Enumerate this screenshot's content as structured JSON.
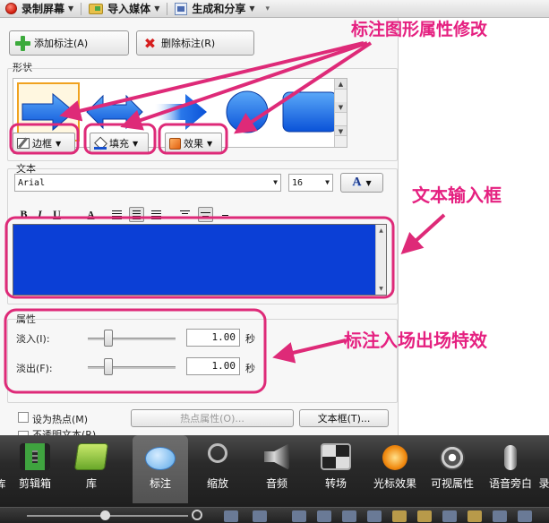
{
  "menubar": {
    "record": "录制屏幕",
    "import": "导入媒体",
    "produce": "生成和分享"
  },
  "callout": {
    "add_label": "添加标注(A)",
    "delete_label": "删除标注(R)",
    "shape_section": "形状",
    "border_label": "边框",
    "fill_label": "填充",
    "effect_label": "效果",
    "text_section": "文本",
    "font_name": "Arial",
    "font_size": "16",
    "format_bold": "B",
    "format_italic": "I",
    "format_underline": "U",
    "format_color": "A",
    "color_dropdown_glyph": "A",
    "props_section": "属性",
    "fade_in_label": "淡入(I):",
    "fade_out_label": "淡出(F):",
    "fade_in_value": "1.00",
    "fade_out_value": "1.00",
    "seconds_unit": "秒",
    "hotspot_label": "设为热点(M)",
    "hotspot_props_label": "热点属性(O)...",
    "textbox_label": "文本框(T)...",
    "partial_checkbox_label": "不透明文本(R)",
    "fill_color": "#0b3fd6",
    "shapes": [
      "right-arrow",
      "double-arrow",
      "right-arrow-faded",
      "circle",
      "rounded-rect"
    ]
  },
  "annotations": {
    "shape_props": "标注图形属性修改",
    "text_box": "文本输入框",
    "fade_effects": "标注入场出场特效",
    "accent_color": "#e52080"
  },
  "dock": {
    "items": [
      {
        "label": "剪辑箱",
        "icon": "film-strip-icon"
      },
      {
        "label": "库",
        "icon": "library-folder-icon"
      },
      {
        "label": "标注",
        "icon": "speech-bubble-icon"
      },
      {
        "label": "缩放",
        "icon": "magnifier-icon"
      },
      {
        "label": "音频",
        "icon": "speaker-icon"
      },
      {
        "label": "转场",
        "icon": "transition-icon"
      },
      {
        "label": "光标效果",
        "icon": "cursor-effect-icon"
      },
      {
        "label": "可视属性",
        "icon": "visual-props-icon"
      },
      {
        "label": "语音旁白",
        "icon": "microphone-icon"
      }
    ],
    "left_fragment": "库",
    "right_fragment": "录"
  }
}
